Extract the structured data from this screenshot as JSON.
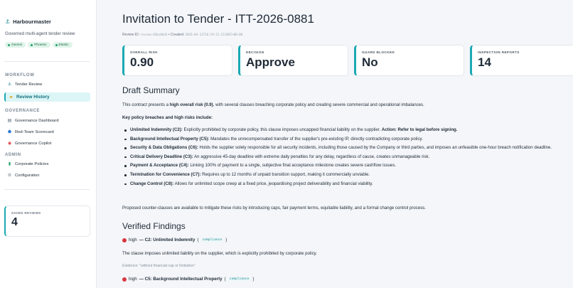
{
  "sidebar": {
    "brand": "Harbourmaster",
    "tagline": "Governed multi-agent tender review",
    "providers": [
      "Gemini",
      "Phoenix",
      "Elastic"
    ],
    "sections": {
      "workflow": "WORKFLOW",
      "governance": "GOVERNANCE",
      "admin": "ADMIN"
    },
    "items": [
      {
        "label": "Tender Review",
        "icon": "anchor-icon"
      },
      {
        "label": "Review History",
        "icon": "folder-icon",
        "active": true
      },
      {
        "label": "Governance Dashboard",
        "icon": "dashboard-icon"
      },
      {
        "label": "Red-Team Scorecard",
        "icon": "shield-icon"
      },
      {
        "label": "Governance Copilot",
        "icon": "copilot-icon"
      },
      {
        "label": "Corporate Policies",
        "icon": "book-icon"
      },
      {
        "label": "Configuration",
        "icon": "gear-icon"
      }
    ],
    "saved_reviews": {
      "label": "SAVED REVIEWS",
      "value": "4"
    }
  },
  "main": {
    "title": "Invitation to Tender - ITT-2026-0881",
    "meta": {
      "review_id_label": "Review ID:",
      "review_id": "review-63bc0bd3",
      "created_label": "• Created:",
      "created": "2026-04-11T16:29:31.511092+00:00"
    },
    "cards": [
      {
        "label": "OVERALL RISK",
        "value": "0.90"
      },
      {
        "label": "DECISION",
        "value": "Approve"
      },
      {
        "label": "GUARD BLOCKED",
        "value": "No"
      },
      {
        "label": "INSPECTION REPORTS",
        "value": "14"
      }
    ],
    "draft_summary": {
      "heading": "Draft Summary",
      "intro_a": "This contract presents a ",
      "intro_b": "high overall risk (0.9)",
      "intro_c": ", with several clauses breaching corporate policy and creating severe commercial and operational imbalances.",
      "key_heading": "Key policy breaches and high risks include:",
      "bullets": [
        {
          "title": "Unlimited Indemnity (C2):",
          "text": " Explicitly prohibited by corporate policy, this clause imposes uncapped financial liability on the supplier. ",
          "action": "Action: Refer to legal before signing."
        },
        {
          "title": "Background Intellectual Property (C5):",
          "text": " Mandates the unrecompensated transfer of the supplier's pre-existing IP, directly contradicting corporate policy."
        },
        {
          "title": "Security & Data Obligations (C6):",
          "text": " Holds the supplier solely responsible for all security incidents, including those caused by the Company or third parties, and imposes an unfeasible one-hour breach notification deadline."
        },
        {
          "title": "Critical Delivery Deadline (C3):",
          "text": " An aggressive 45-day deadline with extreme daily penalties for any delay, regardless of cause, creates unmanageable risk."
        },
        {
          "title": "Payment & Acceptance (C4):",
          "text": " Linking 100% of payment to a single, subjective final acceptance milestone creates severe cashflow issues."
        },
        {
          "title": "Termination for Convenience (C7):",
          "text": " Requires up to 12 months of unpaid transition support, making it commercially unviable."
        },
        {
          "title": "Change Control (C8):",
          "text": " Allows for unlimited scope creep at a fixed price, jeopardising project deliverability and financial viability."
        }
      ],
      "closing": "Proposed counter-clauses are available to mitigate these risks by introducing caps, fair payment terms, equitable liability, and a formal change control process."
    },
    "verified_findings": {
      "heading": "Verified Findings",
      "items": [
        {
          "severity": "high",
          "title": "— C2: Unlimited Indemnity",
          "tag": "compliance",
          "description": "The clause imposes unlimited liability on the supplier, which is explicitly prohibited by corporate policy.",
          "evidence": "Evidence: \"without financial cap or limitation\""
        },
        {
          "severity": "high",
          "title": "— C5: Background Intellectual Property",
          "tag": "compliance"
        }
      ]
    }
  },
  "colors": {
    "accent": "#1aa9b3",
    "high_severity": "#d9363e",
    "pill_bg": "#dff4ea"
  }
}
